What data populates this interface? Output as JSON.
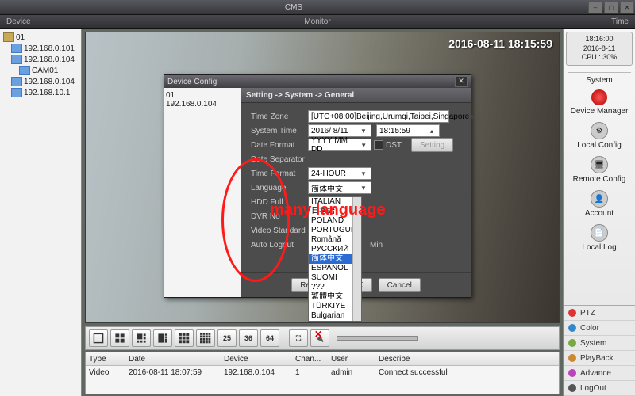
{
  "app": {
    "title": "CMS"
  },
  "menubar": {
    "left": "Device",
    "center": "Monitor",
    "right": "Time"
  },
  "tree": {
    "root": "01",
    "items": [
      "192.168.0.101",
      "192.168.0.104",
      "CAM01",
      "192.168.0.104",
      "192.168.10.1"
    ]
  },
  "video": {
    "osd": "2016-08-11 18:15:59"
  },
  "clock": {
    "time": "18:16:00",
    "date": "2016-8-11",
    "cpu": "CPU : 30%"
  },
  "right_menu": {
    "heading": "System",
    "items": [
      "Device Manager",
      "Local Config",
      "Remote Config",
      "Account",
      "Local Log"
    ]
  },
  "right_btns": [
    "PTZ",
    "Color",
    "System",
    "PlayBack",
    "Advance",
    "LogOut"
  ],
  "right_btn_colors": [
    "#d33",
    "#38c",
    "#7a4",
    "#c83",
    "#b4b",
    "#555"
  ],
  "viewbar": {
    "nums": [
      "25",
      "36",
      "64"
    ]
  },
  "log": {
    "headers": [
      "Type",
      "Date",
      "Device",
      "Chan...",
      "User",
      "Describe"
    ],
    "row": [
      "Video",
      "2016-08-11 18:07:59",
      "192.168.0.104",
      "1",
      "admin",
      "Connect successful"
    ]
  },
  "modal": {
    "title": "Device Config",
    "tree_root": "01",
    "tree_item": "192.168.0.104",
    "breadcrumb": "Setting -> System -> General",
    "fields": {
      "timezone_l": "Time Zone",
      "timezone_v": "[UTC+08:00]Beijing,Urumqi,Taipei,Singapore",
      "systime_l": "System Time",
      "systime_d": "2016/ 8/11",
      "systime_t": "18:15:59",
      "datefmt_l": "Date Format",
      "datefmt_v": "YYYY MM DD",
      "dst_l": "DST",
      "setting_btn": "Setting",
      "datesep_l": "Date Separator",
      "timefmt_l": "Time Format",
      "timefmt_v": "24-HOUR",
      "lang_l": "Language",
      "lang_v": "简体中文",
      "hdd_l": "HDD Full",
      "dvr_l": "DVR No",
      "vstd_l": "Video Standard",
      "autolo_l": "Auto Logout",
      "autolo_unit": "Min"
    },
    "lang_options": [
      "ITALIAN",
      "日本語",
      "POLAND",
      "PORTUGUÊ",
      "Română",
      "РУССКИЙ",
      "简体中文",
      "ESPAÑOL",
      "SUOMI",
      "???",
      "繁體中文",
      "TÜRKİYE",
      "Bulgarian"
    ],
    "lang_selected_index": 6,
    "buttons": {
      "refresh": "Refresh",
      "ok": "OK",
      "cancel": "Cancel"
    }
  },
  "annotation": "many language"
}
